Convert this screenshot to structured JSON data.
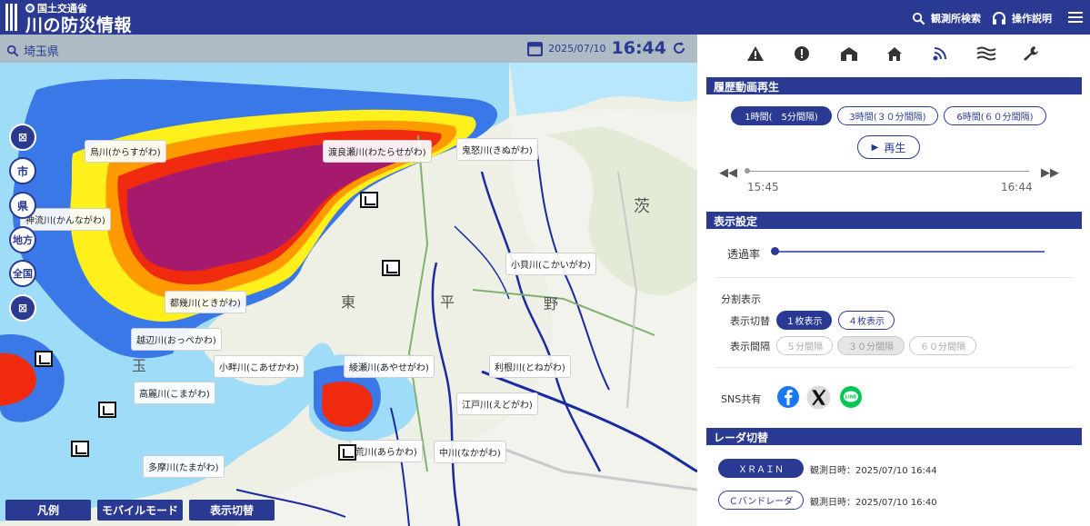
{
  "header": {
    "ministry": "国土交通省",
    "title": "川の防災情報",
    "search_station": "観測所検索",
    "help": "操作説明"
  },
  "topbar": {
    "prefecture": "埼玉県",
    "date": "2025/07/10",
    "time": "16:44"
  },
  "map": {
    "rivers": [
      "烏川(からすがわ)",
      "渡良瀬川(わたらせがわ)",
      "鬼怒川(きぬがわ)",
      "神流川(かんながわ)",
      "小貝川(こかいがわ)",
      "都幾川(ときがわ)",
      "越辺川(おっぺかわ)",
      "小畔川(こあぜかわ)",
      "綾瀬川(あやせがわ)",
      "利根川(とねがわ)",
      "高麗川(こまがわ)",
      "江戸川(えどがわ)",
      "荒川(あらかわ)",
      "中川(なかがわ)",
      "多摩川(たまがわ)"
    ],
    "places": [
      "茨",
      "東",
      "平",
      "野",
      "玉"
    ],
    "scale_buttons": [
      "市",
      "県",
      "地方",
      "全国"
    ],
    "bottom_buttons": {
      "legend": "凡例",
      "mobile": "モバイルモード",
      "display": "表示切替"
    },
    "colors": {
      "rain_light": "#9fdcf7",
      "rain_blue": "#3a78e8",
      "rain_yellow": "#ffef1a",
      "rain_orange": "#ff9a00",
      "rain_red": "#f02a0f",
      "rain_purple": "#a51a6d"
    }
  },
  "panel": {
    "tool_icons": [
      "warning-icon",
      "alert-icon",
      "station-icon",
      "home-icon",
      "radar-icon",
      "flood-icon",
      "wrench-icon"
    ],
    "history": {
      "title": "履歴動画再生",
      "options": [
        "1時間(　5分間隔)",
        "3時間(３０分間隔)",
        "6時間(６０分間隔)"
      ],
      "play": "再生",
      "start": "15:45",
      "end": "16:44"
    },
    "display": {
      "title": "表示設定",
      "opacity": "透過率",
      "split": "分割表示",
      "switch_label": "表示切替",
      "switch_options": [
        "１枚表示",
        "４枚表示"
      ],
      "interval_label": "表示間隔",
      "interval_options": [
        "５分間隔",
        "３０分間隔",
        "６０分間隔"
      ],
      "share": "SNS共有"
    },
    "radar": {
      "title": "レーダ切替",
      "items": [
        {
          "name": "ＸＲＡＩＮ",
          "time": "観測日時：2025/07/10 16:44"
        },
        {
          "name": "Ｃバンドレーダ",
          "time": "観測日時：2025/07/10 16:40"
        }
      ]
    }
  }
}
